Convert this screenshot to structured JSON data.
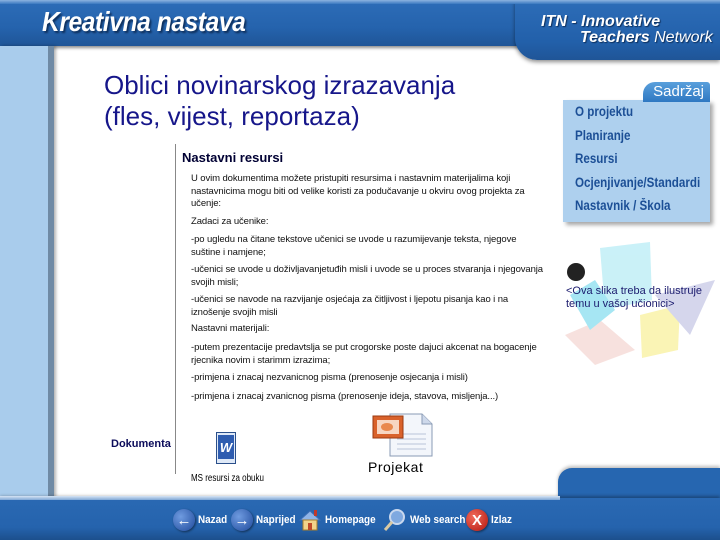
{
  "header": {
    "app_title": "Kreativna nastava",
    "network_line1": "ITN - Innovative",
    "network_line2_bold": "Teachers",
    "network_line2_rest": " Network"
  },
  "page": {
    "title_line1": "Oblici novinarskog izrazavanja",
    "title_line2": "(fles, vijest, reportaza)",
    "section_heading": "Nastavni resursi",
    "paragraphs": [
      "U ovim dokumentima možete pristupiti resursima i nastavnim materijalima koji nastavnicima mogu biti od velike koristi za podučavanje u okviru ovog projekta za učenje:",
      "Zadaci za učenike:",
      "-po ugledu na čitane tekstove učenici se uvode u razumijevanje teksta, njegove suštine i namjene;",
      "-učenici se uvode u doživljavanjetuđih misli i uvode se u proces stvaranja i njegovanja svojih misli;",
      "-učenici se navode na razvijanje osjećaja za čitljivost i ljepotu pisanja kao i na iznošenje svojih misli",
      "Nastavni materijali:",
      "-putem prezentacije predavtslja se put crogorske poste dajuci akcenat na bogacenje rjecnika novim i starimm izrazima;",
      "-primjena i znacaj nezvanicnog pisma (prenosenje osjecanja i misli)",
      "-primjena i znacaj zvanicnog pisma (prenosenje ideja, stavova, misljenja...)"
    ]
  },
  "sidebar": {
    "tab_label": "Sadržaj",
    "items": [
      {
        "label": "O  projektu"
      },
      {
        "label": "Planiranje"
      },
      {
        "label": "Resursi"
      },
      {
        "label": "Ocjenjivanje/Standardi"
      },
      {
        "label": "Nastavnik / Škola"
      }
    ]
  },
  "clipart": {
    "icon": "teacher-classroom-clipart",
    "caption": "<Ova slika treba da ilustruje temu u vašoj učionici>"
  },
  "documents": {
    "label": "Dokumenta",
    "items": [
      {
        "icon": "word-document-icon",
        "label": "MS resursi za obuku"
      },
      {
        "icon": "powerpoint-document-icon",
        "label": "Projekat"
      }
    ]
  },
  "nav": {
    "items": [
      {
        "icon": "arrow-left-icon",
        "label": "Nazad"
      },
      {
        "icon": "arrow-right-icon",
        "label": "Naprijed"
      },
      {
        "icon": "home-icon",
        "label": "Homepage"
      },
      {
        "icon": "magnifier-icon",
        "label": "Web search"
      },
      {
        "icon": "close-x-icon",
        "label": "Izlaz"
      }
    ]
  },
  "colors": {
    "brand_blue": "#2563ad",
    "title_navy": "#16168a",
    "menu_text": "#1c4f96",
    "menu_bg": "#aed0ee"
  }
}
